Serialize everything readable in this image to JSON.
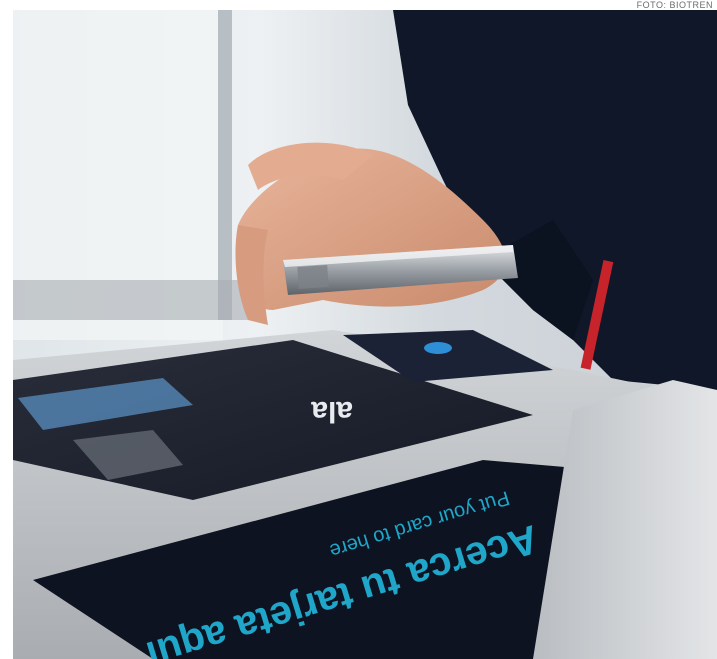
{
  "photo_credit": "FOTO: BIOTREN",
  "photo": {
    "subject": "hand-holding-phone-over-card-reader",
    "reader_logo": "ala",
    "reader_instruction_es": "Acerca tu tarjeta aquí",
    "reader_instruction_en": "Put your card to here"
  },
  "colors": {
    "jacket": "#0f1728",
    "reader_panel": "#0e1322",
    "text_cyan": "#1fa6c8",
    "accent_red": "#c7232a",
    "steel": "#bfc3c7"
  }
}
